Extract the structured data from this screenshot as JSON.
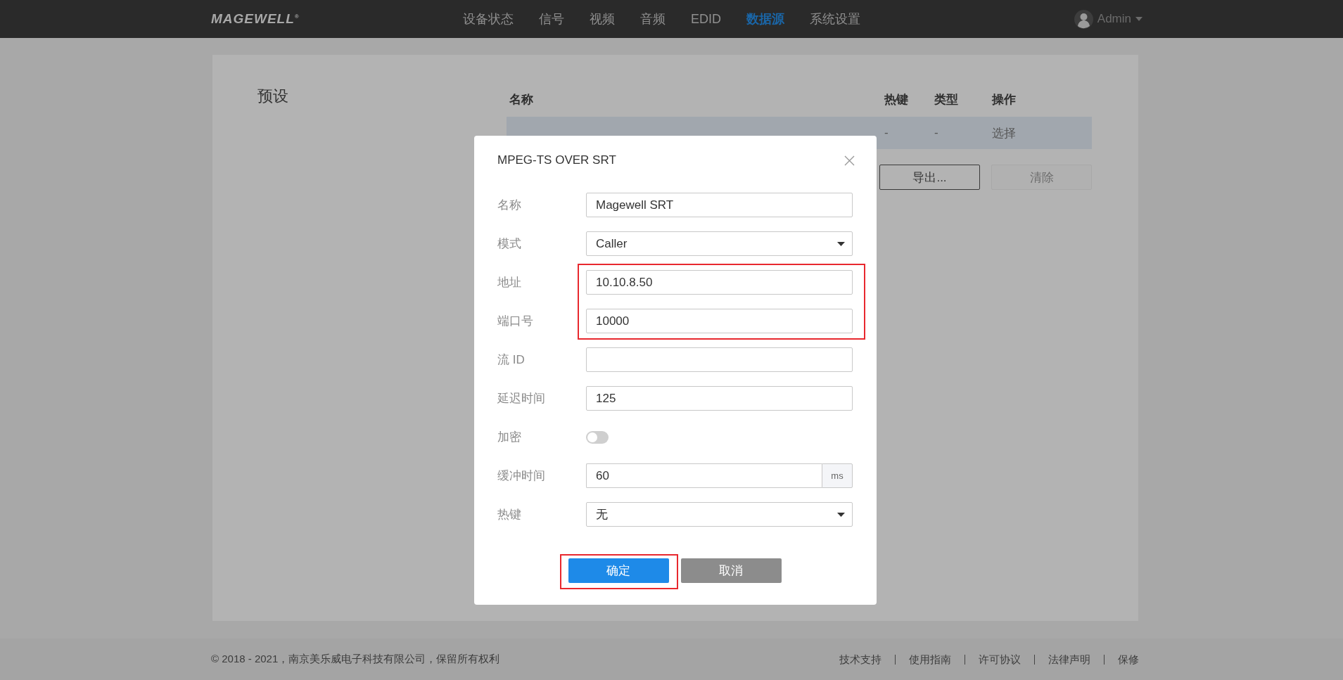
{
  "header": {
    "logo": "MAGEWELL$^{®}$",
    "nav": [
      {
        "label": "设备状态",
        "selected": false
      },
      {
        "label": "信号",
        "selected": false
      },
      {
        "label": "视频",
        "selected": false
      },
      {
        "label": "音频",
        "selected": false
      },
      {
        "label": "EDID",
        "selected": false
      },
      {
        "label": "数据源",
        "selected": true
      },
      {
        "label": "系统设置",
        "selected": false
      }
    ],
    "user": "Admin"
  },
  "presets": {
    "title": "预设",
    "columns": [
      "名称",
      "热键",
      "类型",
      "操作"
    ],
    "rows": [
      {
        "cells": [
          "",
          "-",
          "-"
        ],
        "action": "选择",
        "selected": true
      }
    ],
    "buttons": [
      {
        "label": "导出...",
        "disabled": false
      },
      {
        "label": "清除",
        "disabled": true
      }
    ]
  },
  "dialog": {
    "title": "MPEG-TS OVER SRT",
    "fields": [
      {
        "label": "名称",
        "kind": "text",
        "value": "Magewell SRT",
        "highlighted": false
      },
      {
        "label": "模式",
        "kind": "select",
        "value": "Caller",
        "highlighted": false
      },
      {
        "label": "地址",
        "kind": "text",
        "value": "10.10.8.50",
        "highlighted": true
      },
      {
        "label": "端口号",
        "kind": "text",
        "value": "10000",
        "highlighted": true
      },
      {
        "label": "流 ID",
        "kind": "text",
        "highlighted": false
      },
      {
        "label": "延迟时间",
        "kind": "text",
        "value": "125",
        "highlighted": false
      },
      {
        "label": "加密",
        "kind": "toggle",
        "on": false,
        "highlighted": false
      },
      {
        "label": "缓冲时间",
        "kind": "unit",
        "value": "60",
        "unit": "ms",
        "highlighted": false
      },
      {
        "label": "热键",
        "kind": "select",
        "value": "无",
        "highlighted": false
      }
    ],
    "buttons": [
      {
        "label": "确定",
        "kind": "primary",
        "highlighted": true
      },
      {
        "label": "取消",
        "kind": "secondary",
        "highlighted": false
      }
    ]
  },
  "footer": {
    "copyright": "© 2018 - 2021，南京美乐威电子科技有限公司，保留所有权利",
    "links": [
      "技术支持",
      "使用指南",
      "许可协议",
      "法律声明",
      "保修"
    ]
  }
}
